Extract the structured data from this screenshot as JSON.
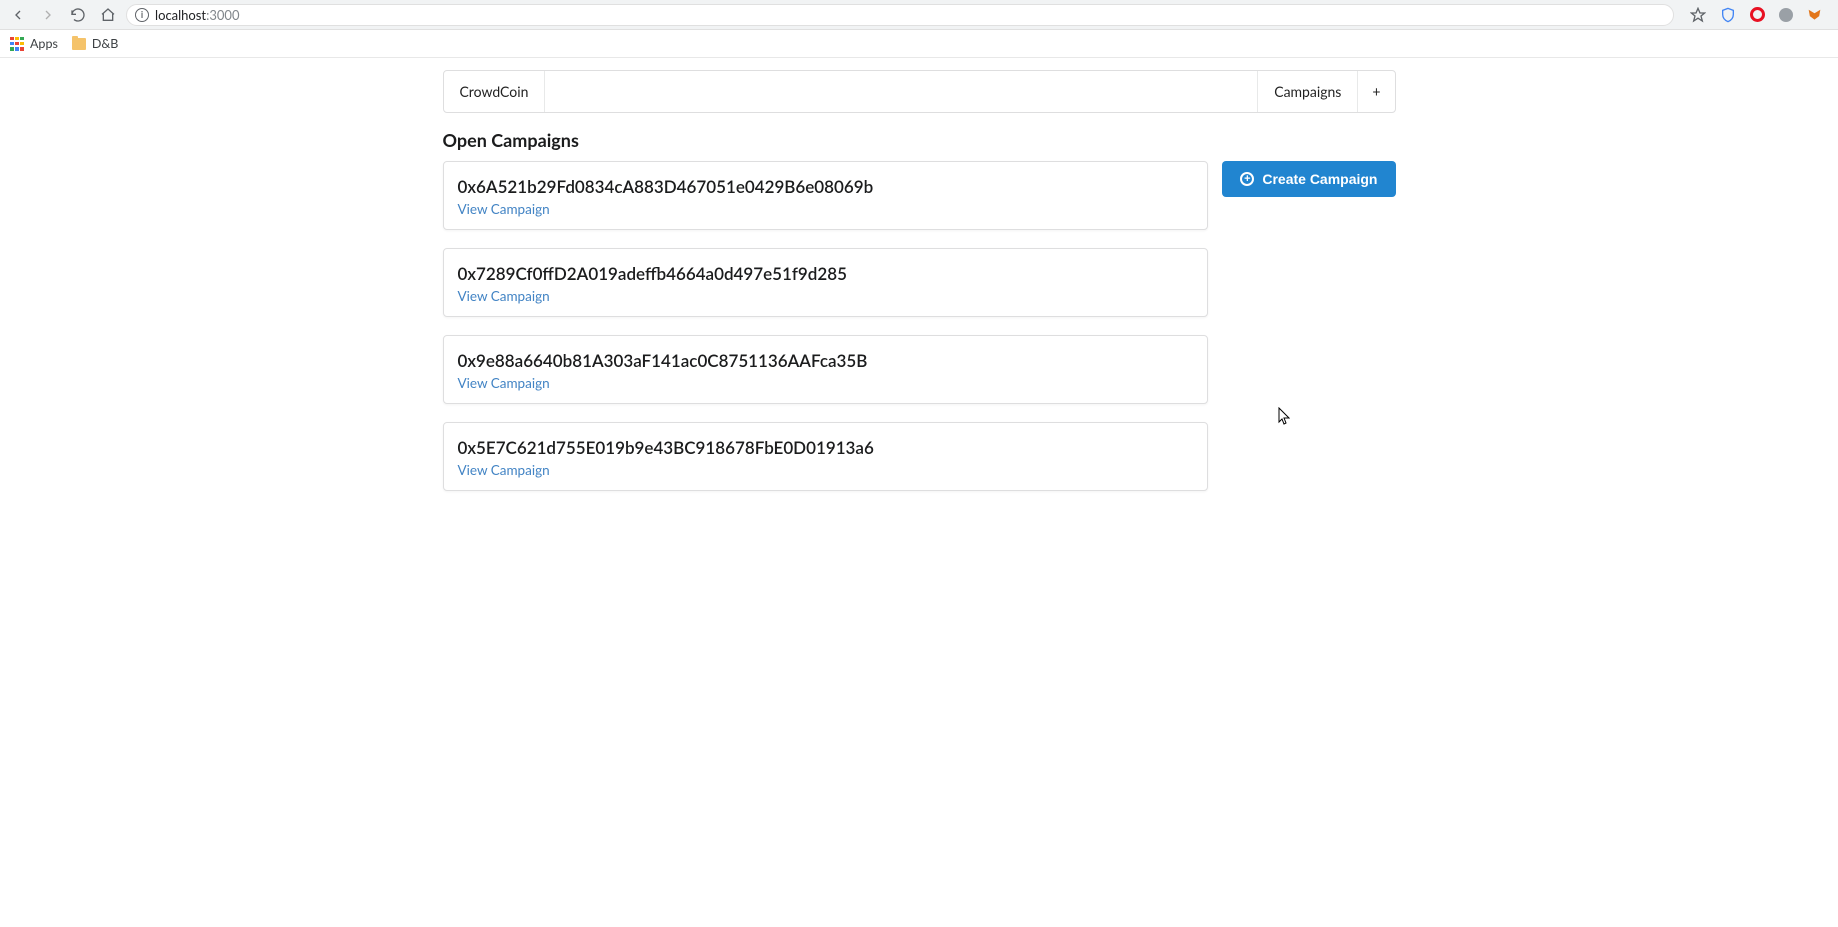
{
  "browser": {
    "url_host": "localhost",
    "url_port": ":3000",
    "bookmarks": {
      "apps_label": "Apps",
      "folder1": "D&B"
    }
  },
  "menu": {
    "brand": "CrowdCoin",
    "campaigns": "Campaigns",
    "plus": "+"
  },
  "heading": "Open Campaigns",
  "create_btn": "Create Campaign",
  "view_label": "View Campaign",
  "campaigns": [
    {
      "address": "0x6A521b29Fd0834cA883D467051e0429B6e08069b"
    },
    {
      "address": "0x7289Cf0ffD2A019adeffb4664a0d497e51f9d285"
    },
    {
      "address": "0x9e88a6640b81A303aF141ac0C8751136AAFca35B"
    },
    {
      "address": "0x5E7C621d755E019b9e43BC918678FbE0D01913a6"
    }
  ]
}
